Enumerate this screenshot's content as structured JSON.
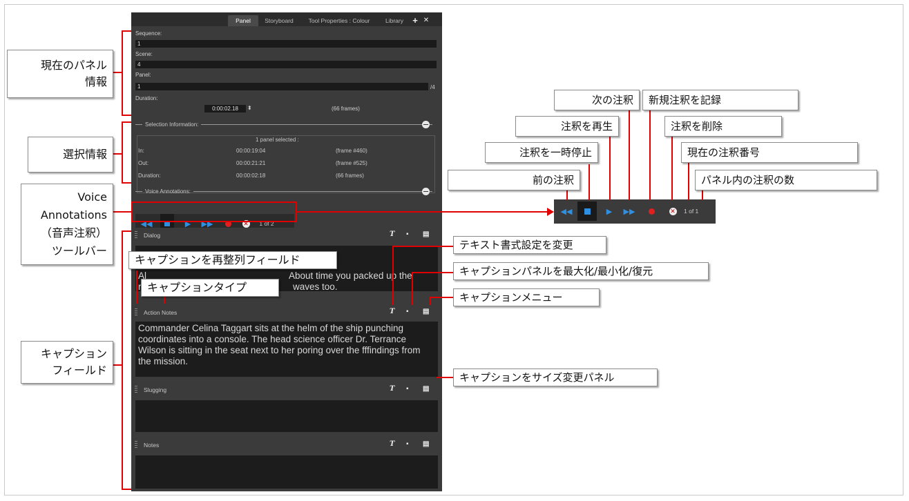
{
  "panel": {
    "tabs": [
      "Panel",
      "Storyboard",
      "Tool Properties : Colour",
      "Library"
    ],
    "tab_add": "+",
    "tab_close": "✕",
    "sequence_label": "Sequence:",
    "sequence_value": "1",
    "scene_label": "Scene:",
    "scene_value": "4",
    "panel_label": "Panel:",
    "panel_value": "1",
    "panel_total": "/4",
    "duration_label": "Duration:",
    "duration_value": "0:00:02.18",
    "duration_frames": "(66 frames)",
    "selection_title": "Selection Information:",
    "selection_count": "1 panel selected :",
    "sel_rows": [
      {
        "label": "In:",
        "time": "00:00:19:04",
        "frames": "(frame #460)"
      },
      {
        "label": "Out:",
        "time": "00:00:21:21",
        "frames": "(frame #525)"
      },
      {
        "label": "Duration:",
        "time": "00:00:02:18",
        "frames": "(66 frames)"
      }
    ],
    "voice_title": "Voice Annotations:",
    "voice_counter": "1 of 2",
    "captions": [
      {
        "title": "Dialog",
        "text": "Alright ..... About time you packed up the ...re waves too."
      },
      {
        "title": "Action Notes",
        "text": "Commander Celina Taggart sits at the helm of the ship punching coordinates into a console. The head science officer Dr. Terrance Wilson is sitting in the seat next to her poring over the fffindings from the mission."
      },
      {
        "title": "Slugging",
        "text": ""
      },
      {
        "title": "Notes",
        "text": ""
      }
    ],
    "dialog_left": "Al",
    "dialog_left2": "re",
    "dialog_right1": "About time you packed up the",
    "dialog_right2": "waves too."
  },
  "mini_toolbar": {
    "counter": "1 of 1"
  },
  "callouts": {
    "current_panel_info": [
      "現在のパネル",
      "情報"
    ],
    "selection_info": "選択情報",
    "voice_toolbar": [
      "Voice",
      "Annotations",
      "（音声注釈）",
      "ツールバー"
    ],
    "caption_fields": [
      "キャプション",
      "フィールド"
    ],
    "reorder_field": "キャプションを再整列フィールド",
    "caption_type": "キャプションタイプ",
    "prev_annotation": "前の注釈",
    "pause_annotation": "注釈を一時停止",
    "play_annotation": "注釈を再生",
    "next_annotation": "次の注釈",
    "record_annotation": "新規注釈を記録",
    "delete_annotation": "注釈を削除",
    "current_annotation_number": "現在の注釈番号",
    "annotation_count": "パネル内の注釈の数",
    "text_format": "テキスト書式設定を変更",
    "maximize_panel": "キャプションパネルを最大化/最小化/復元",
    "caption_menu": "キャプションメニュー",
    "resize_panel": "キャプションをサイズ変更パネル"
  },
  "colors": {
    "accent": "#e00000",
    "play_blue": "#2f8fe0",
    "panel_bg": "#3b3b3b"
  }
}
